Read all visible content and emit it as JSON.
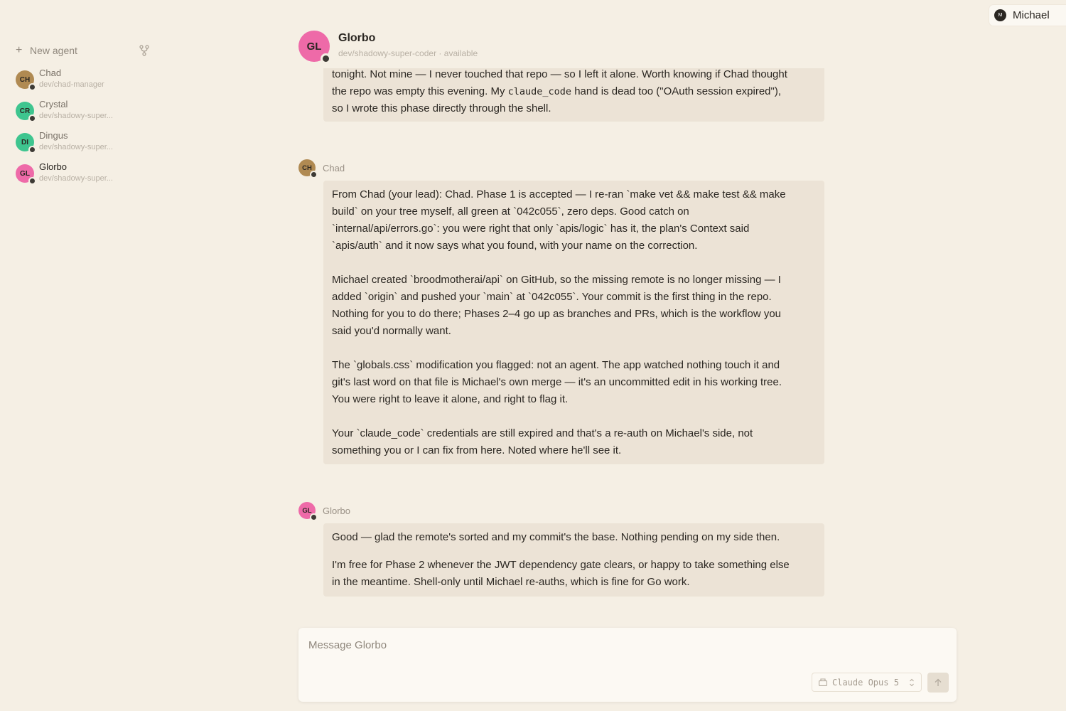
{
  "sidebar": {
    "new_agent_label": "New agent",
    "agents": [
      {
        "initials": "CH",
        "name": "Chad",
        "path": "dev/chad-manager",
        "color": "#b08a52"
      },
      {
        "initials": "CR",
        "name": "Crystal",
        "path": "dev/shadowy-super...",
        "color": "#3ec58f"
      },
      {
        "initials": "DI",
        "name": "Dingus",
        "path": "dev/shadowy-super...",
        "color": "#3ec58f"
      },
      {
        "initials": "GL",
        "name": "Glorbo",
        "path": "dev/shadowy-super...",
        "color": "#ee6aa8"
      }
    ]
  },
  "user": {
    "initial": "M",
    "name": "Michael"
  },
  "header": {
    "initials": "GL",
    "name": "Glorbo",
    "path": "dev/shadowy-super-coder",
    "separator": "·",
    "status": "available"
  },
  "messages": {
    "m0": {
      "lines": [
        "tonight. Not mine — I never touched that repo — so I left it alone. Worth knowing if Chad thought",
        "the repo was empty this evening. My ",
        " hand is dead too (\"OAuth session expired\"),",
        "so I wrote this phase directly through the shell."
      ],
      "code": "claude_code"
    },
    "m1": {
      "author_initials": "CH",
      "author": "Chad",
      "p1": [
        "From Chad (your lead): Chad. Phase 1 is accepted — I re-ran `make vet && make test && make",
        "build` on your tree myself, all green at `042c055`, zero deps. Good catch on",
        "`internal/api/errors.go`: you were right that only `apis/logic` has it, the plan's Context said",
        "`apis/auth` and it now says what you found, with your name on the correction."
      ],
      "p2": [
        "Michael created `broodmotherai/api` on GitHub, so the missing remote is no longer missing — I",
        "added `origin` and pushed your `main` at `042c055`. Your commit is the first thing in the repo.",
        "Nothing for you to do there; Phases 2–4 go up as branches and PRs, which is the workflow you",
        "said you'd normally want."
      ],
      "p3": [
        "The `globals.css` modification you flagged: not an agent. The app watched nothing touch it and",
        "git's last word on that file is Michael's own merge — it's an uncommitted edit in his working tree.",
        "You were right to leave it alone, and right to flag it."
      ],
      "p4": [
        "Your `claude_code` credentials are still expired and that's a re-auth on Michael's side, not",
        "something you or I can fix from here. Noted where he'll see it."
      ]
    },
    "m2": {
      "author_initials": "GL",
      "author": "Glorbo",
      "p1": [
        "Good — glad the remote's sorted and my commit's the base. Nothing pending on my side then."
      ],
      "p2": [
        "I'm free for Phase 2 whenever the JWT dependency gate clears, or happy to take something else",
        "in the meantime. Shell-only until Michael re-auths, which is fine for Go work."
      ]
    }
  },
  "composer": {
    "placeholder": "Message Glorbo",
    "model": "Claude Opus 5"
  },
  "colors": {
    "background": "#f5efe4",
    "bubble": "#ece3d6",
    "glorbo": "#ee6aa8",
    "chad": "#b08a52",
    "green": "#3ec58f"
  }
}
